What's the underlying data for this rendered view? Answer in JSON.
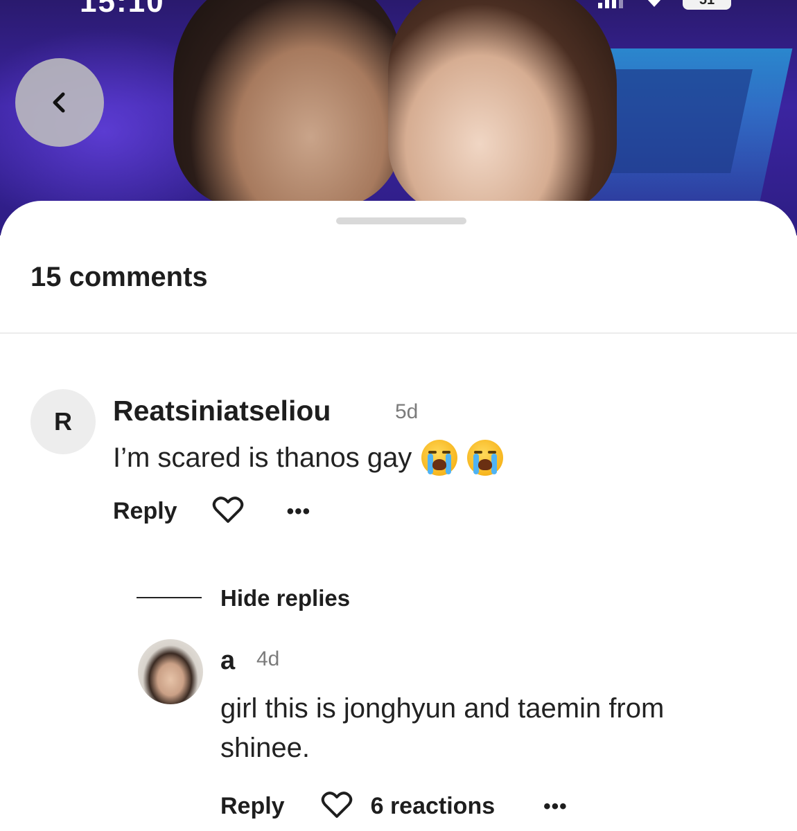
{
  "status_bar": {
    "time": "15:10",
    "battery": "51"
  },
  "header": {
    "back_icon": "chevron-left-icon"
  },
  "comments_panel": {
    "count_label": "15 comments",
    "comments": [
      {
        "avatar_initial": "R",
        "username": "Reatsiniatseliou",
        "time": "5d",
        "text": "I’m scared is thanos gay",
        "emojis": [
          "loudly-crying-face",
          "loudly-crying-face"
        ],
        "reply_label": "Reply",
        "more_label": "•••"
      }
    ],
    "hide_replies_label": "Hide replies",
    "replies": [
      {
        "username": "a",
        "time": "4d",
        "text": "girl this is jonghyun and taemin from shinee.",
        "reply_label": "Reply",
        "reactions_label": "6 reactions",
        "more_label": "•••"
      }
    ]
  }
}
